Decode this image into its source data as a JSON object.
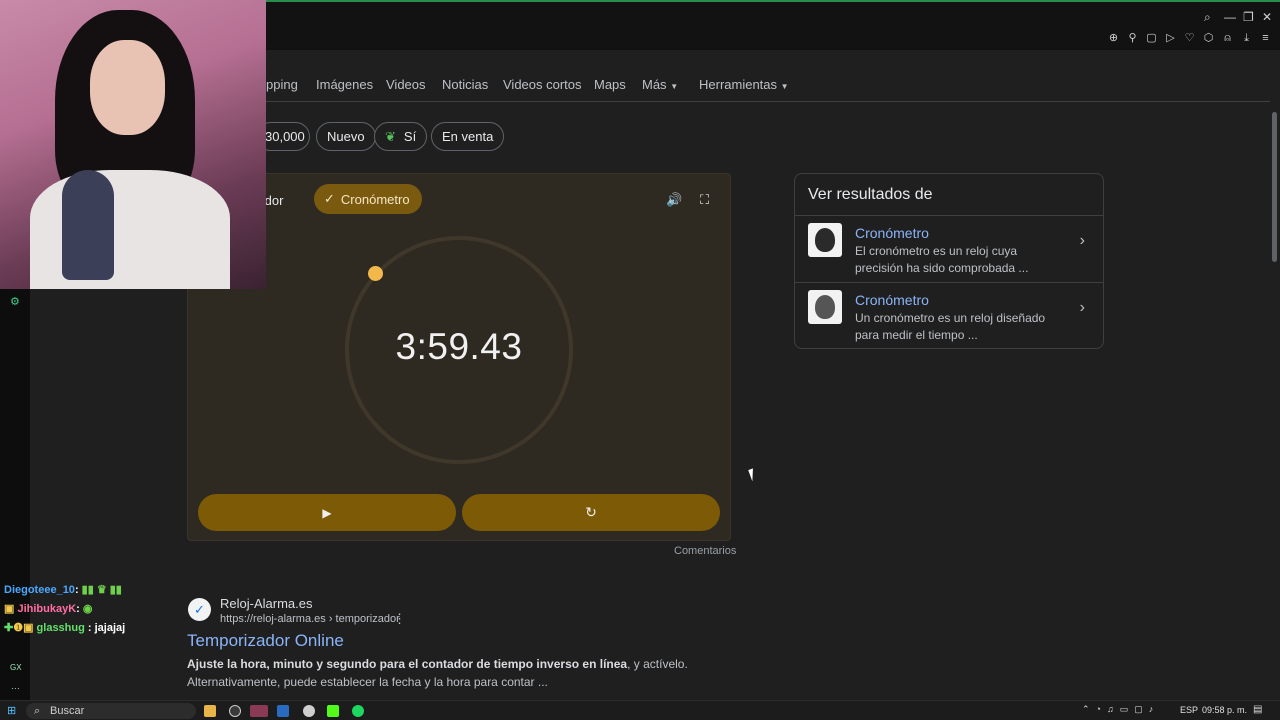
{
  "tabs": [
    "pping",
    "Imágenes",
    "Videos",
    "Noticias",
    "Videos cortos",
    "Maps",
    "Más",
    "Herramientas"
  ],
  "chips": [
    "30,000",
    "Nuevo",
    "Sí",
    "En venta"
  ],
  "stopwatch": {
    "mode_timer_label": "izador",
    "mode_stopwatch_label": "Cronómetro",
    "time": "3:59.43",
    "feedback_label": "Comentarios"
  },
  "right_panel": {
    "title": "Ver resultados de",
    "items": [
      {
        "name": "Cronómetro",
        "desc": "El cronómetro es un reloj cuya precisión ha sido comprobada ..."
      },
      {
        "name": "Cronómetro",
        "desc": "Un cronómetro es un reloj diseñado para medir el tiempo ..."
      }
    ]
  },
  "result": {
    "site": "Reloj-Alarma.es",
    "url": "https://reloj-alarma.es › temporizador",
    "title": "Temporizador Online",
    "snippet_bold": "Ajuste la hora, minuto y segundo para el contador de tiempo inverso en línea",
    "snippet_rest": ", y actívelo. Alternativamente, puede establecer la fecha y la hora para contar ..."
  },
  "chat": [
    {
      "user": "Diegoteee_10",
      "msg": ":",
      "color": "#4aa8ff"
    },
    {
      "user": "JihibukayK",
      "msg": ":",
      "color": "#ff6fa3"
    },
    {
      "user": "glasshug",
      "msg": ": jajajaj",
      "color": "#62e06a"
    }
  ],
  "taskbar": {
    "search_label": "Buscar",
    "lang": "ESP",
    "clock": "09:58 p. m."
  },
  "colors": {
    "accent": "#7d5a06",
    "ring_dot": "#f2b84b",
    "link": "#8ab4f8"
  }
}
